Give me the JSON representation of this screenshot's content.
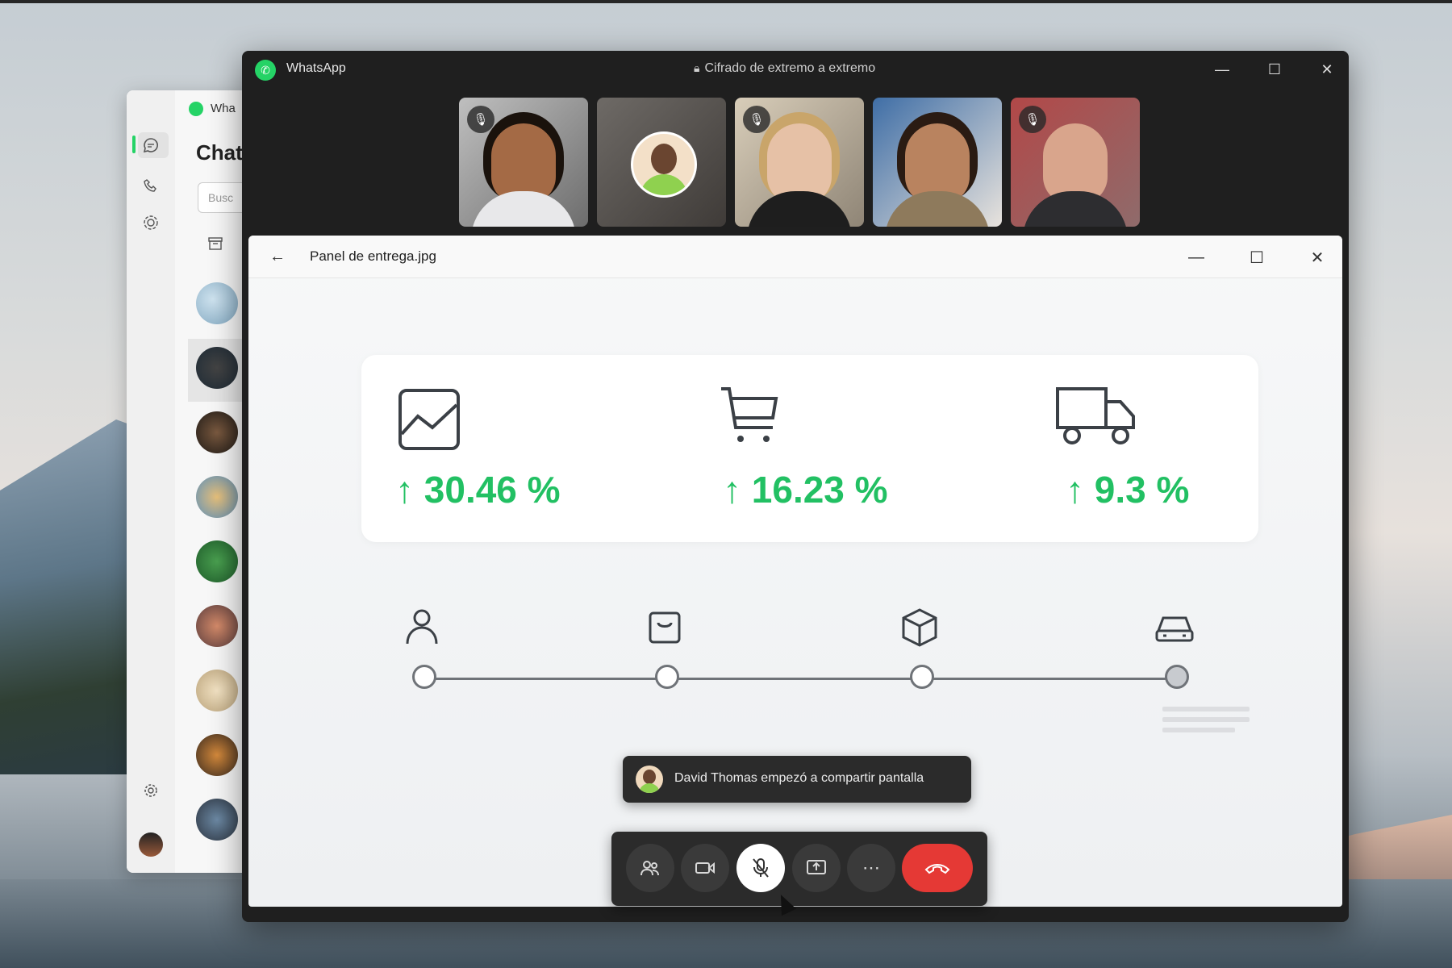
{
  "desktop": {
    "accent": "#25d366"
  },
  "background_window": {
    "title": "Wha",
    "heading": "Chat",
    "search_placeholder": "Busc"
  },
  "call_window": {
    "app_title": "WhatsApp",
    "encryption_label": "Cifrado de extremo a extremo",
    "participants": [
      {
        "muted": true,
        "icon": "mic-off-icon"
      },
      {
        "muted": false,
        "icon": "avatar"
      },
      {
        "muted": true,
        "icon": "mic-off-icon"
      },
      {
        "muted": false,
        "icon": "video"
      },
      {
        "muted": true,
        "icon": "mic-off-icon"
      }
    ]
  },
  "viewer": {
    "title": "Panel de entrega.jpg",
    "stats": [
      {
        "icon": "chart-icon",
        "value": "30.46 %"
      },
      {
        "icon": "cart-icon",
        "value": "16.23 %"
      },
      {
        "icon": "truck-icon",
        "value": "9.3 %"
      }
    ],
    "stages": [
      "person-icon",
      "bag-icon",
      "box-icon",
      "car-icon"
    ],
    "stat_color": "#22c063"
  },
  "toast": {
    "text": "David Thomas empezó a compartir pantalla"
  },
  "controls": {
    "buttons": [
      "participants-icon",
      "camera-icon",
      "mic-off-icon",
      "share-screen-icon",
      "more-icon",
      "end-call-icon"
    ],
    "end_color": "#e53935"
  }
}
